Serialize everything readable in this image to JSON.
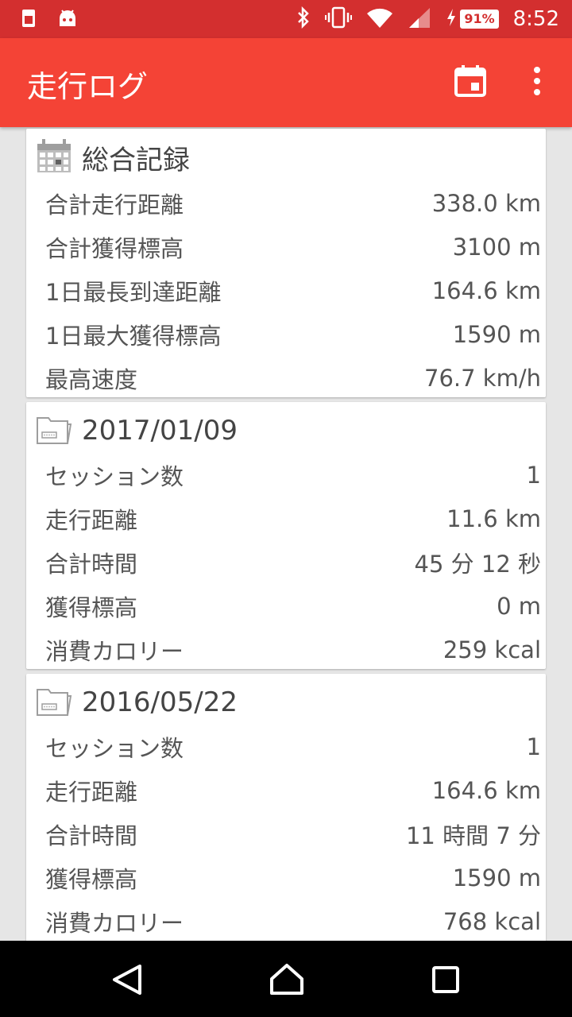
{
  "status_bar": {
    "battery": "91%",
    "time": "8:52"
  },
  "app_bar": {
    "title": "走行ログ"
  },
  "summary": {
    "title": "総合記録",
    "rows": [
      {
        "label": "合計走行距離",
        "value": "338.0 km"
      },
      {
        "label": "合計獲得標高",
        "value": "3100 m"
      },
      {
        "label": "1日最長到達距離",
        "value": "164.6 km"
      },
      {
        "label": "1日最大獲得標高",
        "value": "1590 m"
      },
      {
        "label": "最高速度",
        "value": "76.7 km/h"
      }
    ]
  },
  "days": [
    {
      "date": "2017/01/09",
      "rows": [
        {
          "label": "セッション数",
          "value": "1"
        },
        {
          "label": "走行距離",
          "value": "11.6 km"
        },
        {
          "label": "合計時間",
          "value": "45 分 12 秒"
        },
        {
          "label": "獲得標高",
          "value": "0 m"
        },
        {
          "label": "消費カロリー",
          "value": "259 kcal"
        }
      ]
    },
    {
      "date": "2016/05/22",
      "rows": [
        {
          "label": "セッション数",
          "value": "1"
        },
        {
          "label": "走行距離",
          "value": "164.6 km"
        },
        {
          "label": "合計時間",
          "value": "11 時間 7 分"
        },
        {
          "label": "獲得標高",
          "value": "1590 m"
        },
        {
          "label": "消費カロリー",
          "value": "768 kcal"
        }
      ]
    }
  ],
  "icons": {
    "status_left": [
      "sim-card-icon",
      "android-icon"
    ],
    "status_right": [
      "bluetooth-icon",
      "vibrate-icon",
      "wifi-icon",
      "signal-icon",
      "charging-icon"
    ],
    "app_bar": [
      "calendar-icon",
      "more-vert-icon"
    ],
    "nav": [
      "back-icon",
      "home-icon",
      "recents-icon"
    ]
  },
  "colors": {
    "status_bar": "#d32f2f",
    "app_bar": "#f44336",
    "background": "#e6e6e6"
  }
}
